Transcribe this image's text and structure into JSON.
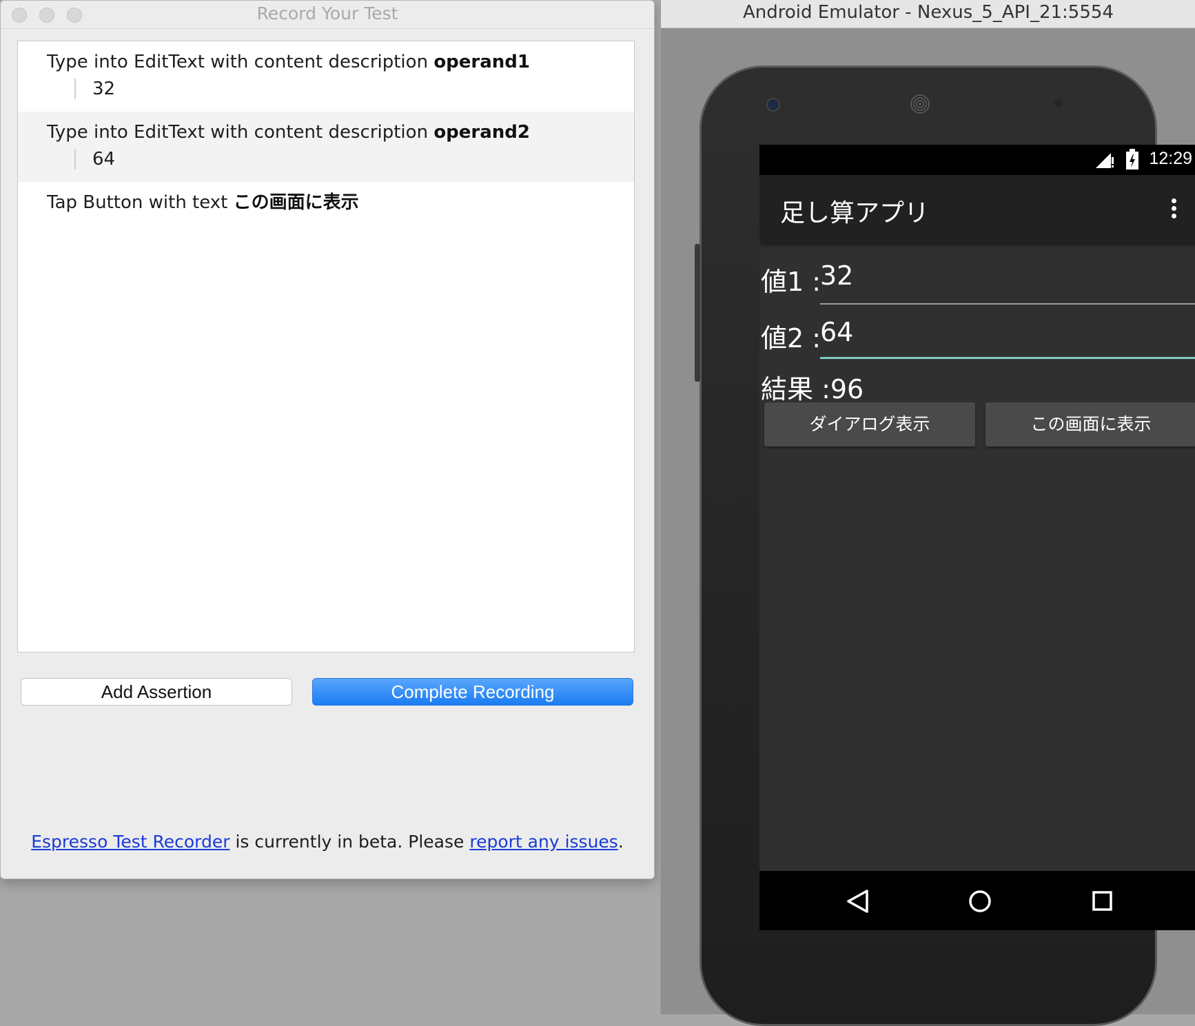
{
  "dialog": {
    "title": "Record Your Test",
    "steps": [
      {
        "prefix": "Type into EditText with content description ",
        "target": "operand1",
        "value": "32"
      },
      {
        "prefix": "Type into EditText with content description ",
        "target": "operand2",
        "value": "64"
      },
      {
        "prefix": "Tap Button with text ",
        "target": "この画面に表示"
      }
    ],
    "add_assertion_label": "Add Assertion",
    "complete_recording_label": "Complete Recording",
    "footer": {
      "link1": "Espresso Test Recorder",
      "middle": " is currently in beta. Please ",
      "link2": "report any issues",
      "end": "."
    }
  },
  "emulator": {
    "window_title": "Android Emulator - Nexus_5_API_21:5554",
    "status_time": "12:29",
    "app_title": "足し算アプリ",
    "field1": {
      "label": "値1 :",
      "value": "32"
    },
    "field2": {
      "label": "値2 :",
      "value": "64"
    },
    "result": "結果 :96",
    "button_dialog": "ダイアログ表示",
    "button_screen": "この画面に表示",
    "accent_underline": "#80cbc4"
  }
}
